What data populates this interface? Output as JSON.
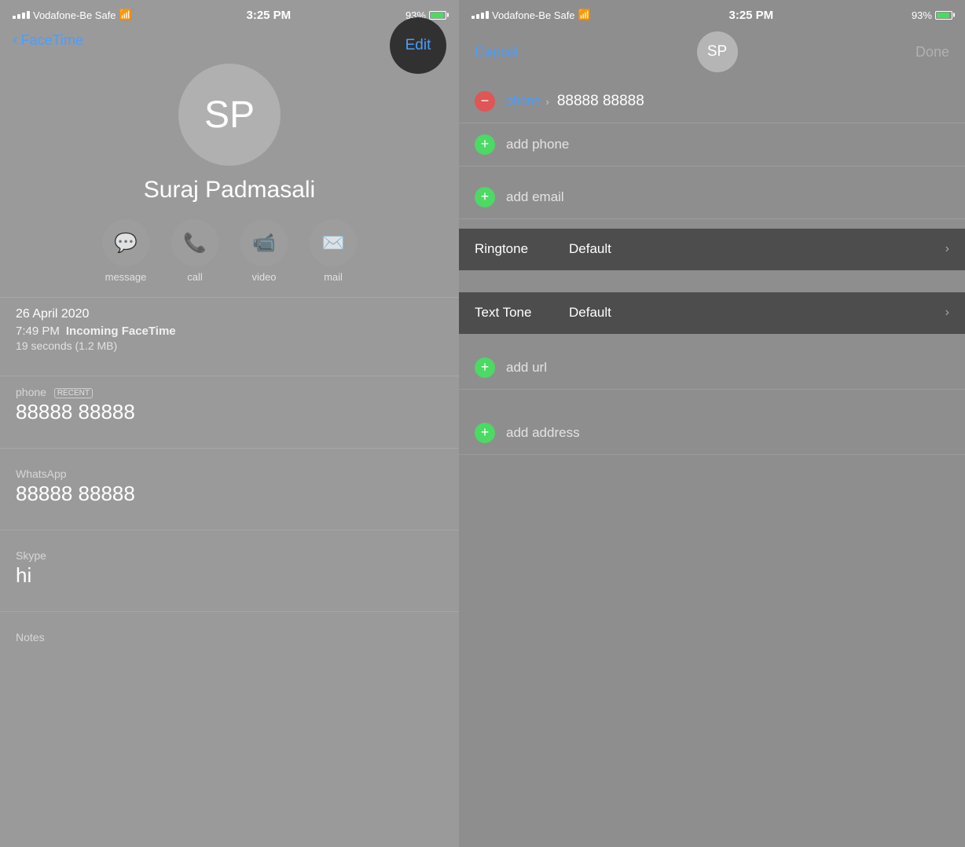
{
  "left": {
    "status": {
      "carrier": "Vodafone-Be Safe",
      "time": "3:25 PM",
      "battery": "93%"
    },
    "nav": {
      "back_label": "FaceTime",
      "edit_label": "Edit"
    },
    "contact": {
      "initials": "SP",
      "name": "Suraj Padmasali"
    },
    "actions": [
      {
        "icon": "💬",
        "label": "message"
      },
      {
        "icon": "📞",
        "label": "call"
      },
      {
        "icon": "📹",
        "label": "video"
      },
      {
        "icon": "✉️",
        "label": "mail"
      }
    ],
    "call_log": {
      "date": "26 April 2020",
      "time": "7:49 PM",
      "type": "Incoming FaceTime",
      "duration": "19 seconds (1.2 MB)"
    },
    "phone": {
      "label": "phone",
      "badge": "RECENT",
      "number": "88888 88888"
    },
    "whatsapp": {
      "label": "WhatsApp",
      "number": "88888 88888"
    },
    "skype": {
      "label": "Skype",
      "value": "hi"
    },
    "notes": {
      "label": "Notes"
    }
  },
  "right": {
    "status": {
      "carrier": "Vodafone-Be Safe",
      "time": "3:25 PM",
      "battery": "93%"
    },
    "nav": {
      "cancel_label": "Cancel",
      "initials": "SP",
      "done_label": "Done"
    },
    "phone_field": {
      "label": "phone",
      "number": "88888 88888"
    },
    "add_phone": "add phone",
    "add_email": "add email",
    "ringtone": {
      "label": "Ringtone",
      "value": "Default"
    },
    "text_tone": {
      "label": "Text Tone",
      "value": "Default"
    },
    "add_url": "add url",
    "add_address": "add address"
  }
}
